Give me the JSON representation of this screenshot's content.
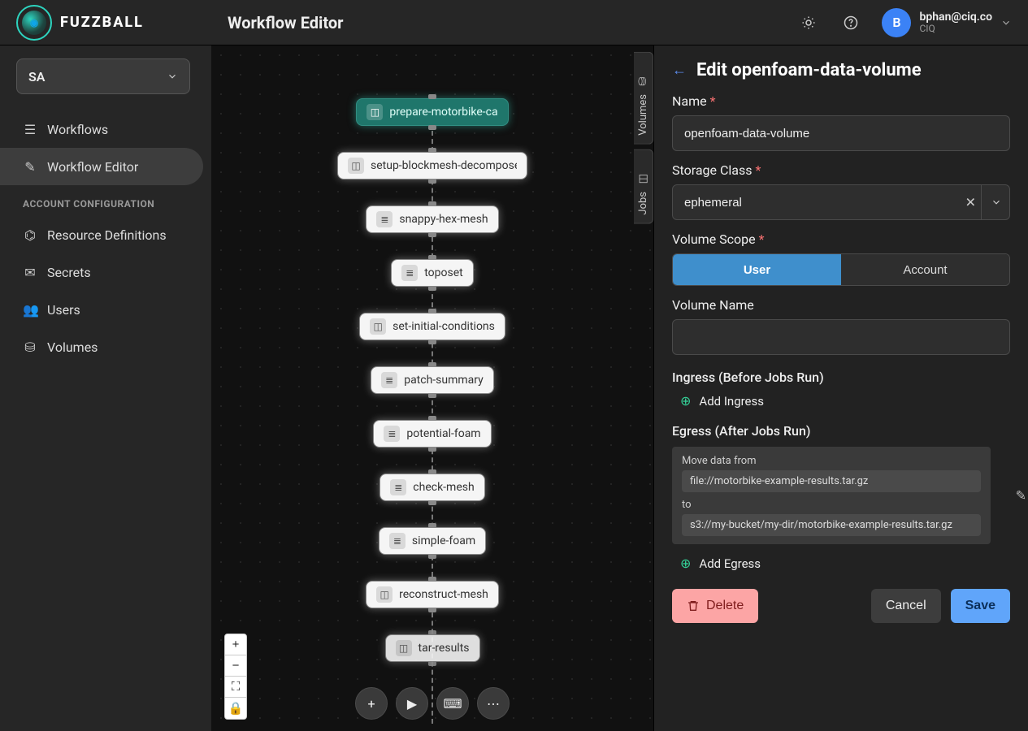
{
  "brand": {
    "name": "FUZZBALL"
  },
  "header": {
    "title": "Workflow Editor"
  },
  "user": {
    "initial": "B",
    "email": "bphan@ciq.co",
    "org": "CIQ"
  },
  "org_select": {
    "value": "SA"
  },
  "nav": {
    "workflows": "Workflows",
    "workflow_editor": "Workflow Editor",
    "section": "ACCOUNT CONFIGURATION",
    "resource_definitions": "Resource Definitions",
    "secrets": "Secrets",
    "users": "Users",
    "volumes": "Volumes"
  },
  "canvas": {
    "side_tab_volumes": "Volumes",
    "side_tab_jobs": "Jobs",
    "nodes": [
      "prepare-motorbike-ca",
      "setup-blockmesh-decompose-p",
      "snappy-hex-mesh",
      "toposet",
      "set-initial-conditions",
      "patch-summary",
      "potential-foam",
      "check-mesh",
      "simple-foam",
      "reconstruct-mesh",
      "tar-results"
    ]
  },
  "panel": {
    "title": "Edit openfoam-data-volume",
    "name_label": "Name",
    "name_value": "openfoam-data-volume",
    "storage_class_label": "Storage Class",
    "storage_class_value": "ephemeral",
    "volume_scope_label": "Volume Scope",
    "scope_user": "User",
    "scope_account": "Account",
    "volume_name_label": "Volume Name",
    "volume_name_value": "",
    "ingress_label": "Ingress (Before Jobs Run)",
    "add_ingress": "Add Ingress",
    "egress_label": "Egress (After Jobs Run)",
    "egress_from_label": "Move data from",
    "egress_from_value": "file://motorbike-example-results.tar.gz",
    "egress_to_label": "to",
    "egress_to_value": "s3://my-bucket/my-dir/motorbike-example-results.tar.gz",
    "add_egress": "Add Egress",
    "delete": "Delete",
    "cancel": "Cancel",
    "save": "Save"
  }
}
